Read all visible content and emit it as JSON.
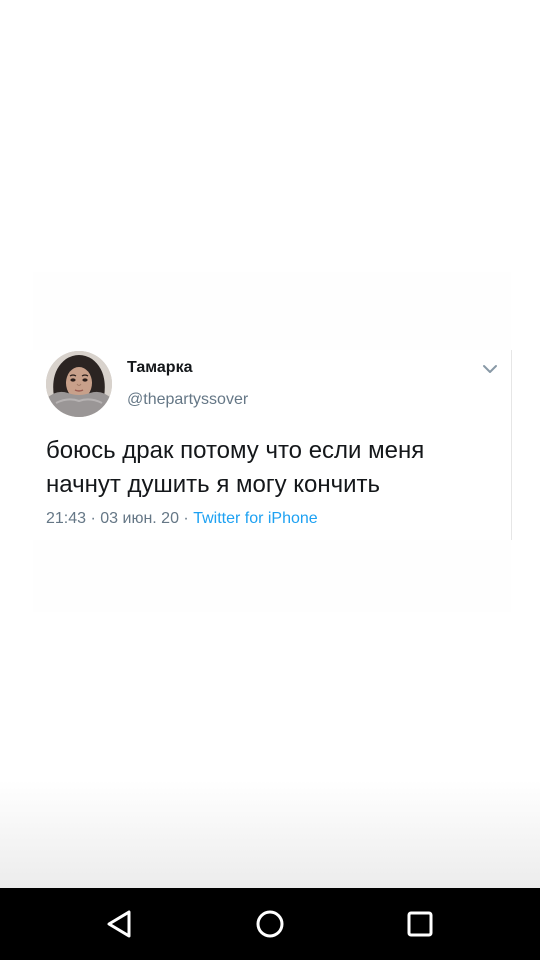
{
  "tweet": {
    "display_name": "Тамарка",
    "handle": "@thepartyssover",
    "text": "боюсь драк потому что если меня начнут душить я могу кончить",
    "time": "21:43",
    "separator": " · ",
    "date": "03 июн. 20",
    "source": "Twitter for iPhone",
    "menu_icon": "chevron-down-icon",
    "avatar_icon": "avatar"
  },
  "nav": {
    "back_icon": "back-triangle-icon",
    "home_icon": "home-circle-icon",
    "recents_icon": "recents-square-icon"
  },
  "colors": {
    "text_primary": "#14171a",
    "text_secondary": "#657786",
    "link": "#1da1f2",
    "nav_bar": "#000000"
  }
}
